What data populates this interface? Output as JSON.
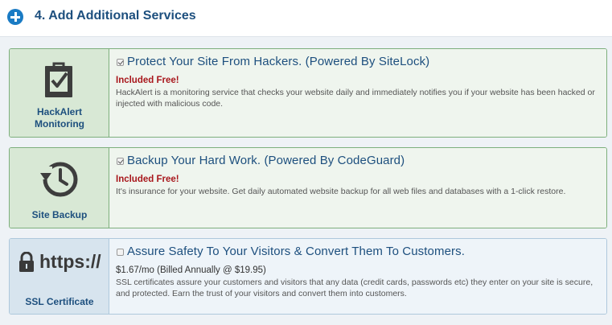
{
  "header": {
    "title": "4. Add Additional Services",
    "icon": "plus-circle-icon",
    "accent": "#1a7bc4"
  },
  "services": [
    {
      "side_label_line1": "HackAlert",
      "side_label_line2": "Monitoring",
      "icon": "shield-check-icon",
      "checked": true,
      "title": "Protect Your Site From Hackers. (Powered By SiteLock)",
      "badge": "Included Free!",
      "description": "HackAlert is a monitoring service that checks your website daily and immediately notifies you if your website has been hacked or injected with malicious code."
    },
    {
      "side_label": "Site Backup",
      "icon": "backup-clock-icon",
      "checked": true,
      "title": "Backup Your Hard Work. (Powered By CodeGuard)",
      "badge": "Included Free!",
      "description": "It's insurance for your website. Get daily automated website backup for all web files and databases with a 1-click restore."
    },
    {
      "side_label": "SSL Certificate",
      "icon": "padlock-icon",
      "icon_text": "https://",
      "checked": false,
      "title": "Assure Safety To Your Visitors & Convert Them To Customers.",
      "price": "$1.67/mo (Billed Annually @ $19.95)",
      "description": "SSL certificates assure your customers and visitors that any data (credit cards, passwords etc) they enter on your site is secure, and protected. Earn the trust of your visitors and convert them into customers."
    }
  ],
  "colors": {
    "included_free": "#a8171c",
    "title_text": "#1d4f7e",
    "card_green_border": "#7daf7d",
    "card_blue_border": "#aec8dc"
  }
}
